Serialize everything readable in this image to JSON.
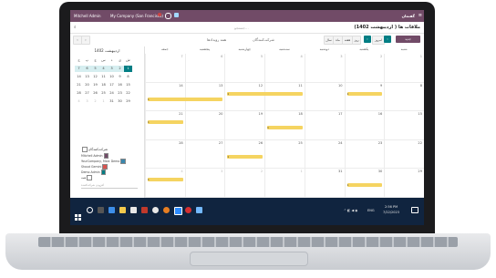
{
  "topbar": {
    "user": "Mitchell Admin",
    "company": "My Company (San Francisco)",
    "app_title": "گفتمان"
  },
  "search": {
    "placeholder": "جستجو..."
  },
  "breadcrumb": "ملاقات ها ( اردیبهشت 1402)",
  "toolbar": {
    "today": "امروز",
    "day": "روز",
    "week": "هفته",
    "month": "ماه",
    "year": "سال",
    "filter_attendees": "شرکت‌کنندگان",
    "filter_all": "همه رویدادها"
  },
  "mini_calendar": {
    "title": "اردیبهشت 1402",
    "weekdays": [
      "ش",
      "ی",
      "د",
      "س",
      "چ",
      "پ",
      "ج"
    ],
    "weeks": [
      [
        "1",
        "2",
        "3",
        "4",
        "5",
        "6",
        "7"
      ],
      [
        "8",
        "9",
        "10",
        "11",
        "12",
        "13",
        "14"
      ],
      [
        "15",
        "16",
        "17",
        "18",
        "19",
        "20",
        "21"
      ],
      [
        "22",
        "23",
        "24",
        "25",
        "26",
        "27",
        "28"
      ],
      [
        "29",
        "30",
        "31",
        "1",
        "2",
        "3",
        "4"
      ]
    ]
  },
  "filters": {
    "header": "شرکت‌کنندگان",
    "items": [
      "Mitchell Admin",
      "YourCompany, Marc Demo",
      "Shoud Gemini",
      "Demo Admin",
      "همه"
    ],
    "search_placeholder": "افزودن شرکت‌کننده"
  },
  "calendar": {
    "days": [
      "شنبه",
      "یکشنبه",
      "دوشنبه",
      "سه‌شنبه",
      "چهارشنبه",
      "پنجشنبه",
      "جمعه"
    ],
    "weeks": [
      [
        "1",
        "2",
        "3",
        "4",
        "5",
        "6",
        "7"
      ],
      [
        "8",
        "9",
        "10",
        "11",
        "12",
        "13",
        "14"
      ],
      [
        "15",
        "16",
        "17",
        "18",
        "19",
        "20",
        "21"
      ],
      [
        "22",
        "23",
        "24",
        "25",
        "26",
        "27",
        "28"
      ],
      [
        "29",
        "30",
        "31",
        "1",
        "2",
        "3",
        "4"
      ]
    ],
    "event_label": "1"
  },
  "tray": {
    "time": "2:56 PM",
    "date": "7/22/2023",
    "lang": "ENG"
  },
  "colors": {
    "brand": "#714b67",
    "teal": "#017e84",
    "event": "#f5d461",
    "taskbar": "#10243f"
  }
}
